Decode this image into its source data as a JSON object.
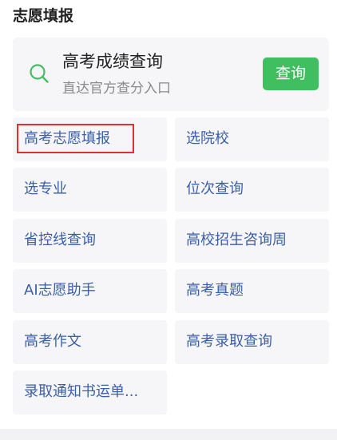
{
  "section": {
    "title": "志愿填报"
  },
  "search_card": {
    "title": "高考成绩查询",
    "subtitle": "直达官方查分入口",
    "button_label": "查询",
    "icon": "search-icon",
    "accent_color": "#3fbf5f"
  },
  "grid": {
    "items": [
      {
        "label": "高考志愿填报",
        "highlighted": true
      },
      {
        "label": "选院校"
      },
      {
        "label": "选专业"
      },
      {
        "label": "位次查询"
      },
      {
        "label": "省控线查询"
      },
      {
        "label": "高校招生咨询周"
      },
      {
        "label": "AI志愿助手"
      },
      {
        "label": "高考真题"
      },
      {
        "label": "高考作文"
      },
      {
        "label": "高考录取查询"
      },
      {
        "label": "录取通知书运单..."
      }
    ]
  }
}
